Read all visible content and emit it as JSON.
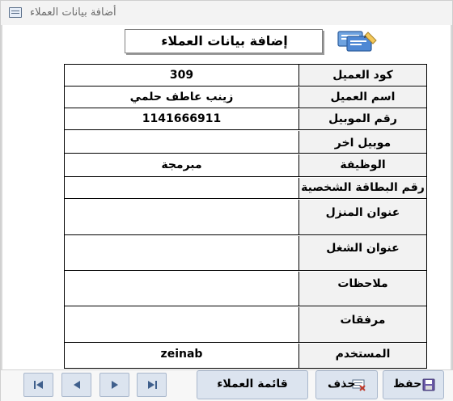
{
  "window": {
    "title": "أضافة بيانات العملاء"
  },
  "header": {
    "title": "إضافة بيانات العملاء"
  },
  "fields": [
    {
      "label": "كود العميل",
      "value": "309"
    },
    {
      "label": "اسم العميل",
      "value": "زينب عاطف حلمي"
    },
    {
      "label": "رقم الموبيل",
      "value": "1141666911"
    },
    {
      "label": "موبيل اخر",
      "value": ""
    },
    {
      "label": "الوظيفة",
      "value": "مبرمجة"
    },
    {
      "label": "رقم البطاقة الشخصية",
      "value": ""
    },
    {
      "label": "عنوان المنزل",
      "value": ""
    },
    {
      "label": "عنوان الشغل",
      "value": ""
    },
    {
      "label": "ملاحظات",
      "value": ""
    },
    {
      "label": "مرفقات",
      "value": ""
    },
    {
      "label": "المستخدم",
      "value": "zeinab"
    }
  ],
  "buttons": {
    "save": "حفظ",
    "delete": "حذف",
    "customers_list": "قائمة العملاء"
  },
  "icons": {
    "window": "form-icon",
    "header": "chat-card-icon",
    "first": "first-record-icon",
    "prev": "previous-record-icon",
    "next": "next-record-icon",
    "last": "last-record-icon",
    "save": "save-disk-icon",
    "delete": "delete-record-icon"
  },
  "colors": {
    "button_bg": "#dce4ef",
    "button_border": "#a9b7cc",
    "label_bg": "#f2f2f2"
  }
}
